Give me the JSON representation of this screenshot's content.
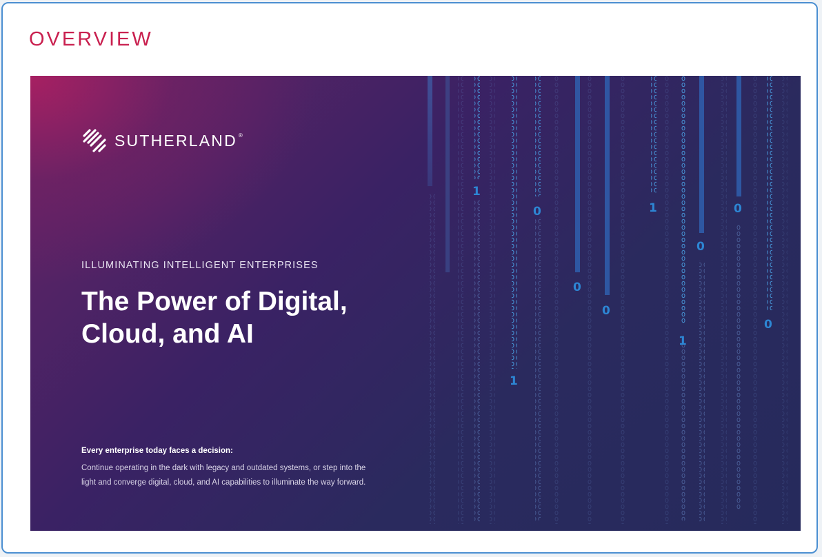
{
  "section": {
    "heading": "OVERVIEW"
  },
  "cover": {
    "brand": {
      "name": "SUTHERLAND",
      "reg_mark": "®"
    },
    "eyebrow": "ILLUMINATING INTELLIGENT ENTERPRISES",
    "title_line1": "The Power of Digital,",
    "title_line2": "Cloud, and AI",
    "lead": "Every enterprise today faces a decision:",
    "description_line1": "Continue operating in the dark with legacy and outdated systems, or step into the",
    "description_line2": "light and converge digital, cloud, and AI capabilities to illuminate the way forward.",
    "binary_digits": [
      "1",
      "0",
      "1",
      "0",
      "0",
      "0",
      "0",
      "1",
      "0",
      "1"
    ]
  },
  "colors": {
    "heading": "#c9204f",
    "border": "#4b8fd1",
    "digit_blue": "#2d86d4"
  }
}
